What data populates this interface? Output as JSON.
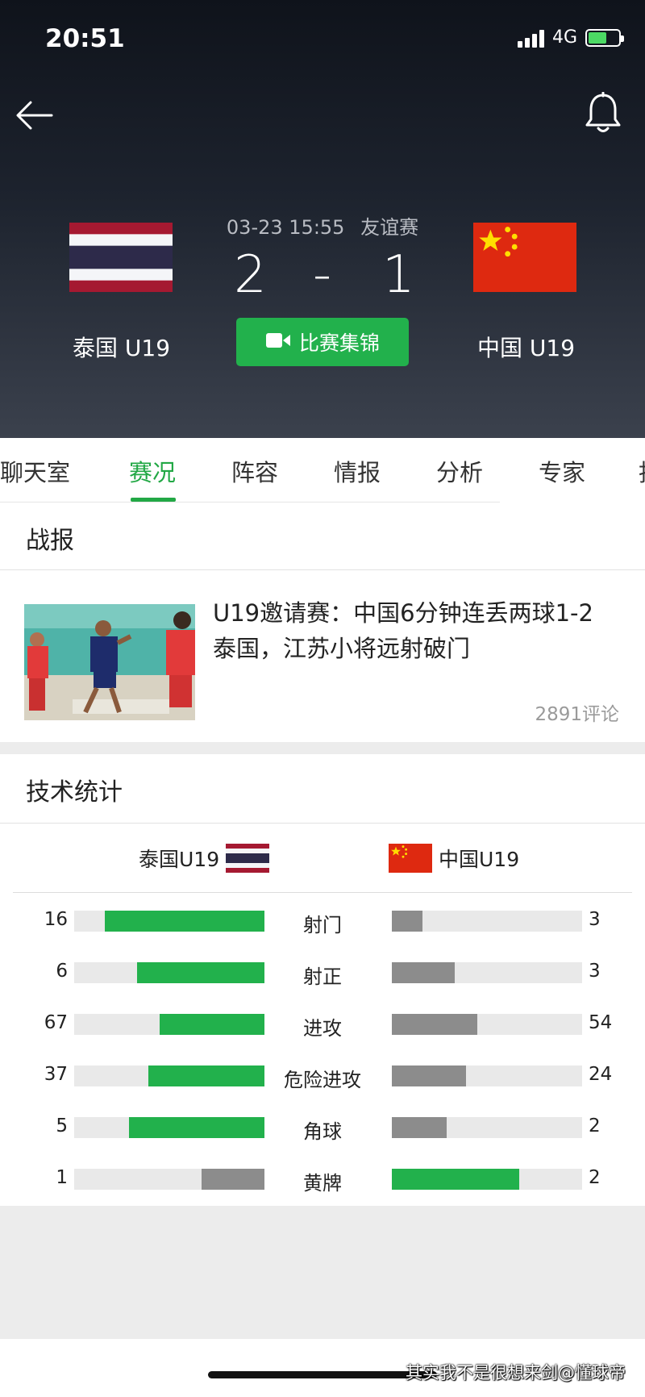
{
  "status_bar": {
    "time": "20:51",
    "network": "4G"
  },
  "match": {
    "datetime": "03-23 15:55",
    "competition": "友谊赛",
    "home_score": "2",
    "separator": "-",
    "away_score": "1",
    "home_team": "泰国 U19",
    "away_team": "中国 U19",
    "highlights_label": "比赛集锦"
  },
  "tabs": [
    "聊天室",
    "赛况",
    "阵容",
    "情报",
    "分析",
    "专家",
    "指"
  ],
  "active_tab": "赛况",
  "report": {
    "title": "战报",
    "news_title": "U19邀请赛：中国6分钟连丢两球1-2泰国，江苏小将远射破门",
    "comments": "2891评论"
  },
  "stats": {
    "title": "技术统计",
    "home_team": "泰国U19",
    "away_team": "中国U19",
    "rows": [
      {
        "label": "射门",
        "home": "16",
        "away": "3",
        "home_frac": 0.84,
        "away_frac": 0.16,
        "home_color": "#22b14c",
        "away_color": "#8c8c8c"
      },
      {
        "label": "射正",
        "home": "6",
        "away": "3",
        "home_frac": 0.67,
        "away_frac": 0.33,
        "home_color": "#22b14c",
        "away_color": "#8c8c8c"
      },
      {
        "label": "进攻",
        "home": "67",
        "away": "54",
        "home_frac": 0.55,
        "away_frac": 0.45,
        "home_color": "#22b14c",
        "away_color": "#8c8c8c"
      },
      {
        "label": "危险进攻",
        "home": "37",
        "away": "24",
        "home_frac": 0.61,
        "away_frac": 0.39,
        "home_color": "#22b14c",
        "away_color": "#8c8c8c"
      },
      {
        "label": "角球",
        "home": "5",
        "away": "2",
        "home_frac": 0.71,
        "away_frac": 0.29,
        "home_color": "#22b14c",
        "away_color": "#8c8c8c"
      },
      {
        "label": "黄牌",
        "home": "1",
        "away": "2",
        "home_frac": 0.33,
        "away_frac": 0.67,
        "home_color": "#8c8c8c",
        "away_color": "#22b14c"
      }
    ]
  },
  "watermark": "其实我不是很想来剑@懂球帝",
  "colors": {
    "accent": "#22a845",
    "button_green": "#22b14c",
    "bar_gray": "#8c8c8c"
  }
}
